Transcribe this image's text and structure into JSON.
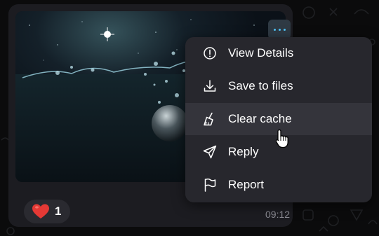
{
  "message": {
    "reaction": {
      "emoji": "red-heart-icon",
      "count": "1"
    },
    "time": "09:12"
  },
  "context_menu": {
    "items": [
      {
        "label": "View Details",
        "icon": "info-icon"
      },
      {
        "label": "Save to files",
        "icon": "download-icon"
      },
      {
        "label": "Clear cache",
        "icon": "broom-icon",
        "hovered": true
      },
      {
        "label": "Reply",
        "icon": "send-icon"
      },
      {
        "label": "Report",
        "icon": "flag-icon"
      }
    ]
  },
  "colors": {
    "accent": "#4fc3f7",
    "menu_bg": "#27272d",
    "hover_bg": "#34343b",
    "bubble_bg": "#1c1c21",
    "heart": "#e53935"
  }
}
